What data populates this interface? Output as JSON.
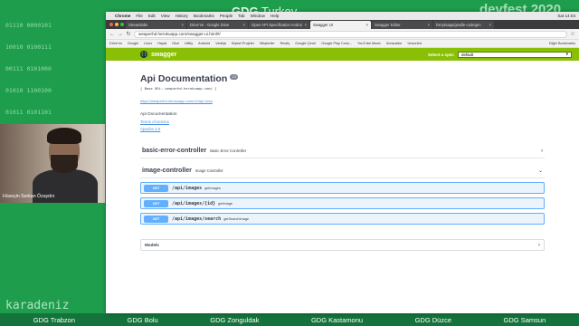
{
  "overlay": {
    "binary_lines": [
      "01110 0000101",
      "10010 0100111",
      "00111 0101000",
      "01010 1100100",
      "01011 0101101"
    ],
    "event_brand": "GDG",
    "event_title": "Turkey",
    "devfest": "devfest 2020",
    "speaker_name": "Hüseyin Serkan Özaydın",
    "region_text": "karadeniz",
    "chapters": [
      "GDG Trabzon",
      "GDG Bolu",
      "GDG Zonguldak",
      "GDG Kastamonu",
      "GDG Düzce",
      "GDG Samsun"
    ]
  },
  "mac_menubar": {
    "apple": "",
    "items": [
      "Chrome",
      "File",
      "Edit",
      "View",
      "History",
      "Bookmarks",
      "People",
      "Tab",
      "Window",
      "Help"
    ],
    "clock": "Sat 14:04"
  },
  "tabs": [
    {
      "title": "Streamlabs",
      "active": false
    },
    {
      "title": "Drive'ım - Google Drive",
      "active": false
    },
    {
      "title": "Open API Specification Androi",
      "active": false
    },
    {
      "title": "Swagger UI",
      "active": true
    },
    {
      "title": "Swagger Editor",
      "active": false
    },
    {
      "title": "hsnytoapp/gradle-codegen",
      "active": false
    }
  ],
  "toolbar": {
    "back": "←",
    "forward": "→",
    "reload": "↻",
    "url": "weaperhd.herokuapp.com/swagger-ui.html#/",
    "star": "☆"
  },
  "bookmarks": {
    "items": [
      "Drive'ım",
      "Google",
      "Linux",
      "Hayat",
      "Okul",
      "Utility",
      "Android",
      "Vedeja",
      "Kişisel Projeler",
      "Müşteriler",
      "Rewfy",
      "Google Çeviri",
      "Google Play Cons...",
      "YouTube Music",
      "Abracador",
      "Unsorted"
    ],
    "other": "Diğer Bookmarks"
  },
  "swagger": {
    "brand": "swagger",
    "logo_glyph": "{·}",
    "spec_label": "Select a spec",
    "spec_value": "default",
    "title": "Api Documentation",
    "version": "1.0",
    "base_url": "[ Base URL: weaperhd.herokuapp.com/ ]",
    "docs_url": "https://weaperhd.herokuapp.com/v2/api-docs",
    "description": "Api Documentation",
    "terms": "Terms of service",
    "license": "Apache 2.0",
    "controllers": [
      {
        "name": "basic-error-controller",
        "description": "Basic Error Controller",
        "arrow": "›"
      },
      {
        "name": "image-controller",
        "description": "Image Controller",
        "arrow": "⌄"
      }
    ],
    "operations": [
      {
        "method": "GET",
        "path": "/api/images",
        "summary": "getImages"
      },
      {
        "method": "GET",
        "path": "/api/images/{id}",
        "summary": "getImage"
      },
      {
        "method": "GET",
        "path": "/api/images/search",
        "summary": "getSearchImage"
      }
    ],
    "models_label": "Models",
    "models_arrow": "›"
  },
  "colors": {
    "background": "#1e9e4c",
    "swagger_green": "#89bf04",
    "get_blue": "#61affe"
  }
}
